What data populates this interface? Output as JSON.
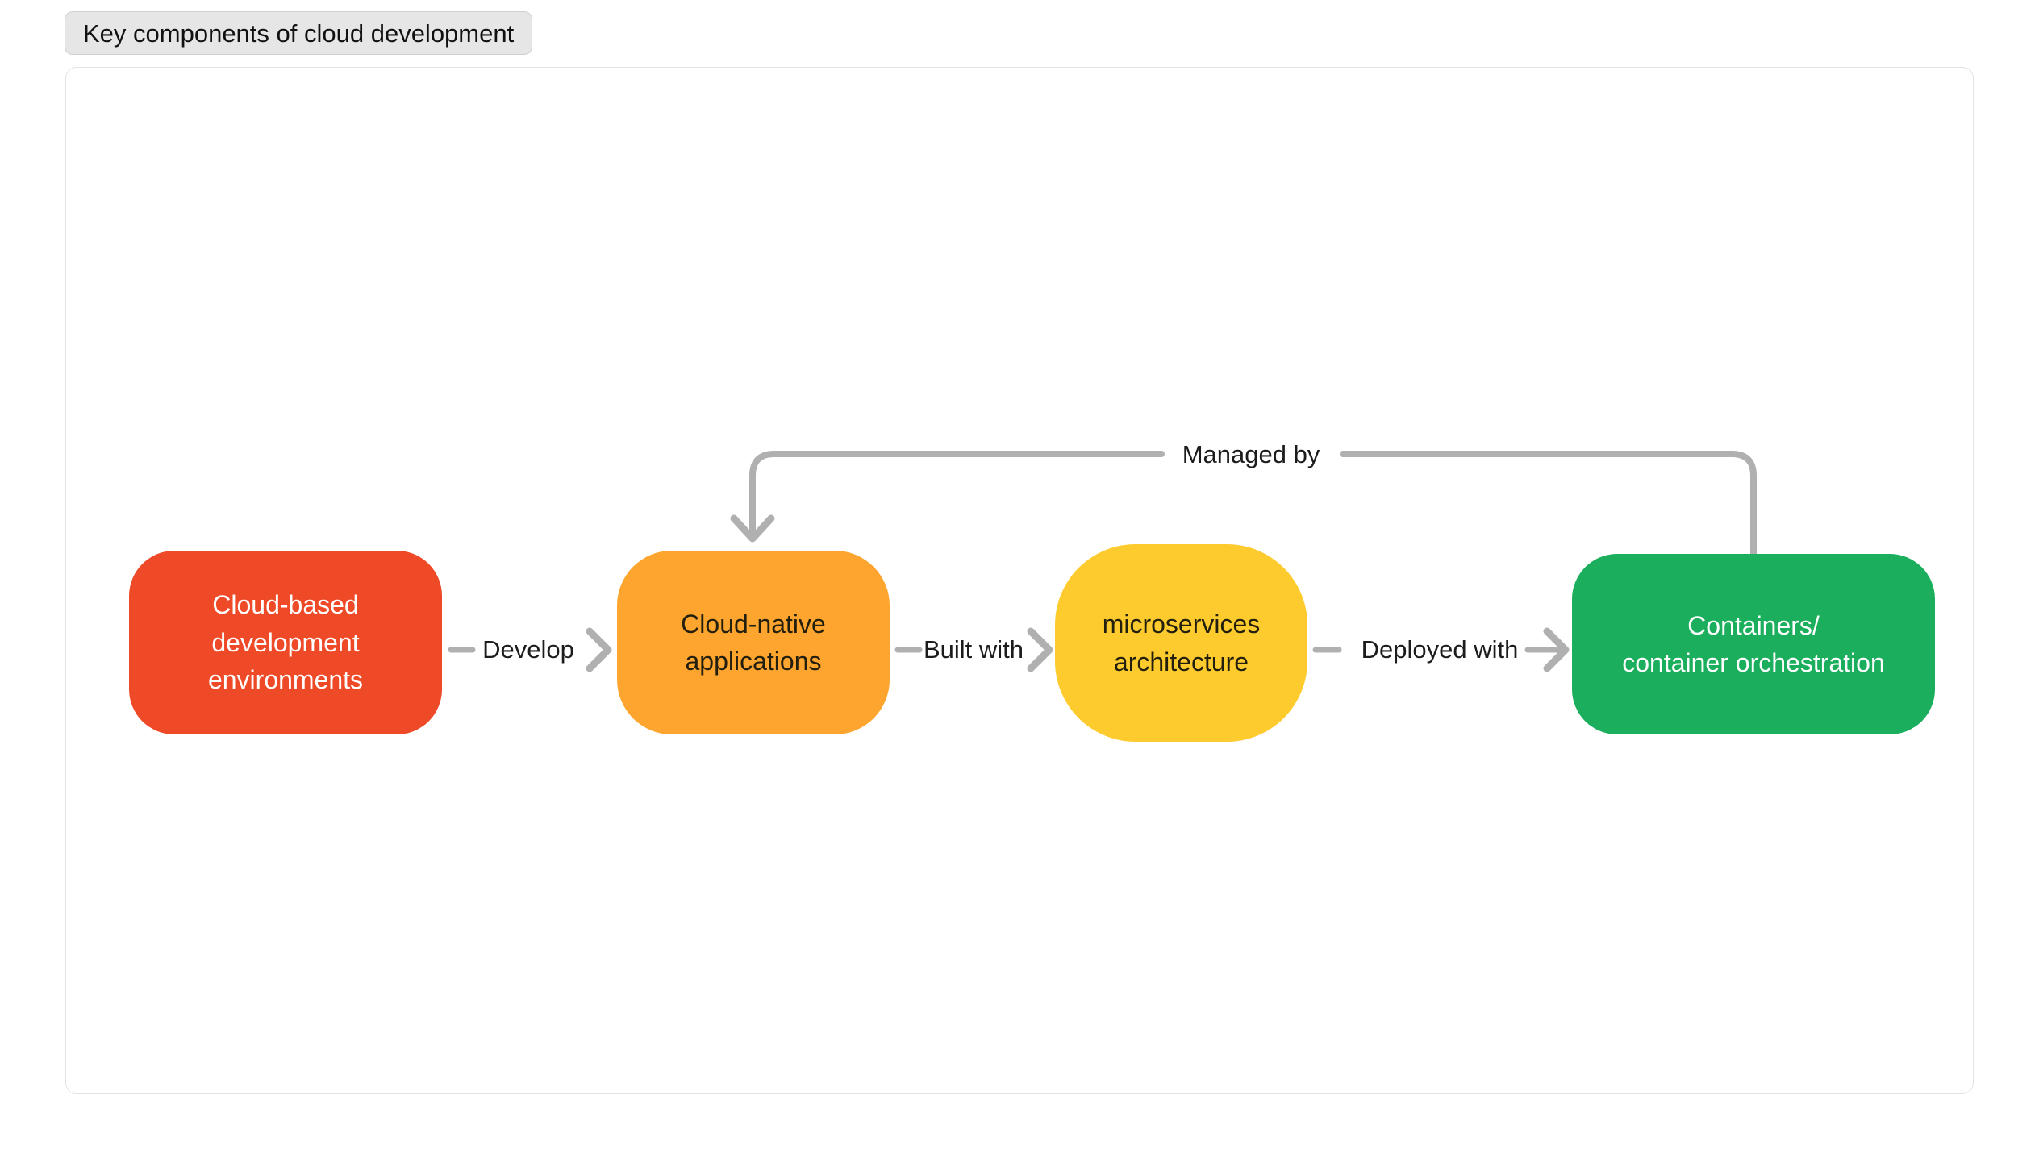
{
  "title_tab": {
    "label": "Key components of cloud development"
  },
  "colors": {
    "node_red": "#ef4a28",
    "node_orange": "#fda52e",
    "node_yellow": "#fdcb2e",
    "node_green": "#1bae5c",
    "edge_gray": "#b0b0b0",
    "tab_background": "#e6e6e6",
    "canvas_border": "#e3e3e3",
    "text_dark": "#231f0e",
    "text_light": "#ffffff"
  },
  "diagram": {
    "type": "flowchart",
    "direction": "left-to-right",
    "nodes": [
      {
        "id": "n0",
        "label": "Cloud-based\ndevelopment\nenvironments",
        "color": "#ef4a28",
        "text_color": "#ffffff"
      },
      {
        "id": "n1",
        "label": "Cloud-native\napplications",
        "color": "#fda52e",
        "text_color": "#231f0e"
      },
      {
        "id": "n2",
        "label": "microservices\narchitecture",
        "color": "#fdcb2e",
        "text_color": "#231f0e"
      },
      {
        "id": "n3",
        "label": "Containers/\ncontainer orchestration",
        "color": "#1bae5c",
        "text_color": "#ffffff"
      }
    ],
    "edges": [
      {
        "id": "e0",
        "from": "n0",
        "to": "n1",
        "label": "Develop",
        "style": "straight"
      },
      {
        "id": "e1",
        "from": "n1",
        "to": "n2",
        "label": "Built with",
        "style": "straight"
      },
      {
        "id": "e2",
        "from": "n2",
        "to": "n3",
        "label": "Deployed with",
        "style": "straight"
      },
      {
        "id": "e3",
        "from": "n3",
        "to": "n1",
        "label": "Managed by",
        "style": "curved-top-loop"
      }
    ]
  }
}
